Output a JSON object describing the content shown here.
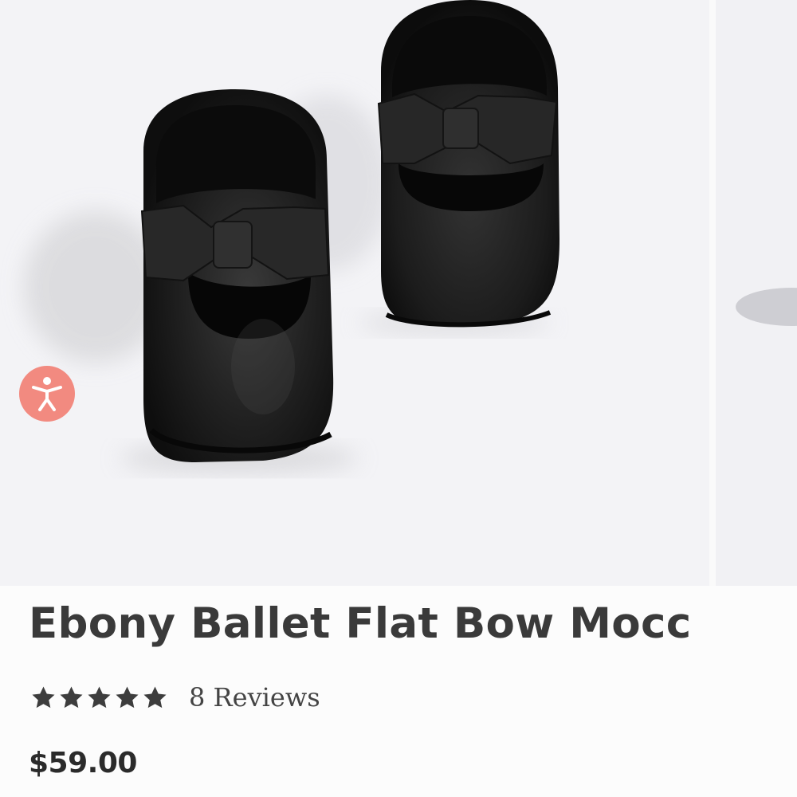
{
  "product": {
    "title": "Ebony Ballet Flat Bow Mocc",
    "rating": 5,
    "max_rating": 5,
    "reviews_label": "8 Reviews",
    "price": "$59.00"
  },
  "icons": {
    "accessibility": "accessibility-icon",
    "star": "star-icon"
  },
  "colors": {
    "accessibility_button": "#f28a80",
    "title_text": "#3a3a3a",
    "star": "#3d3d3d",
    "price_text": "#2b2b2b",
    "image_background": "#f3f3f6"
  }
}
